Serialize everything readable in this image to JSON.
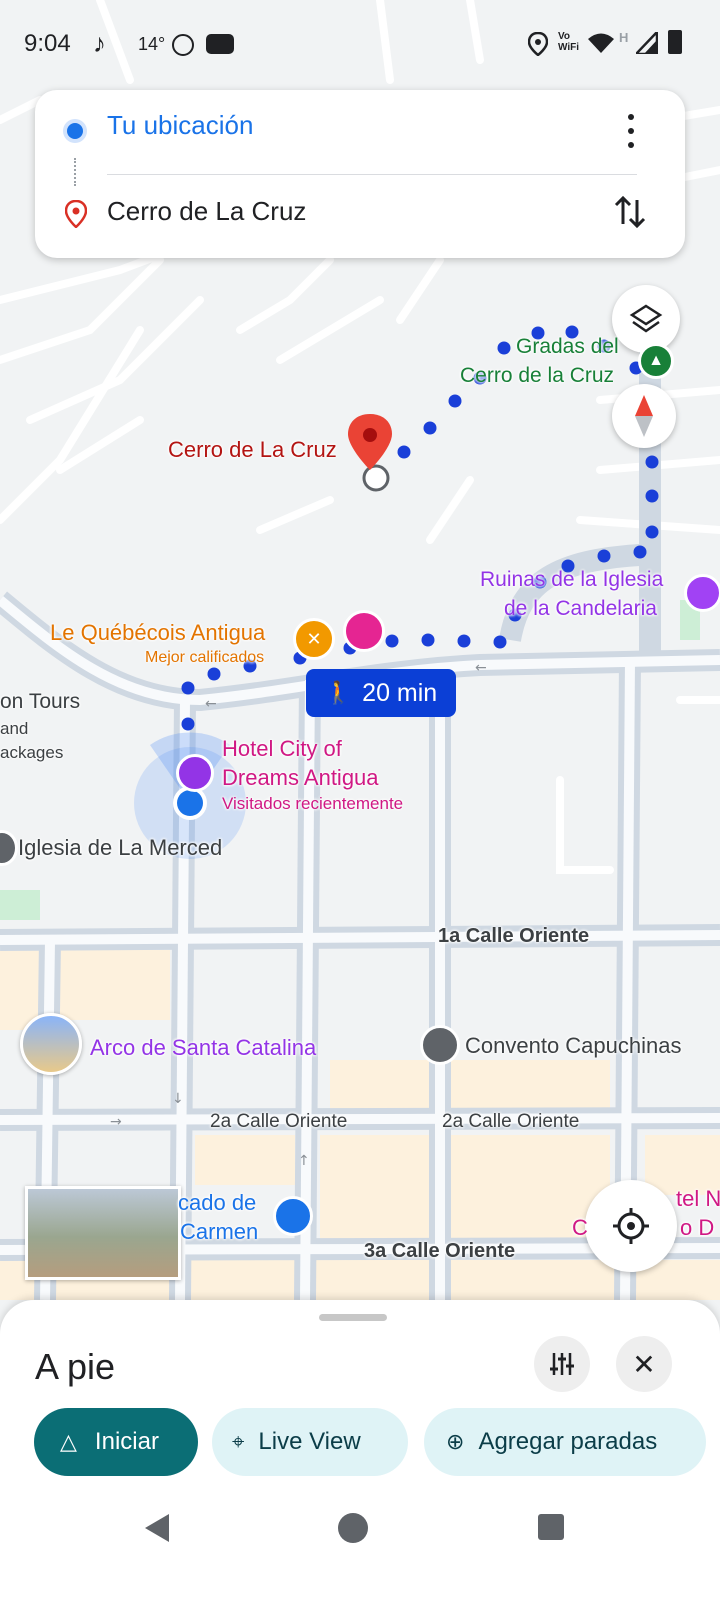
{
  "status_bar": {
    "time": "9:04",
    "temperature": "14°",
    "icons": [
      "tiktok-icon",
      "screen-record-icon",
      "youtube-icon",
      "location-icon",
      "vowifi-icon",
      "wifi-icon",
      "signal-icon",
      "battery-icon"
    ],
    "vowifi_top": "Vo",
    "vowifi_bottom": "WiFi",
    "network_letter": "H"
  },
  "directions": {
    "origin": "Tu ubicación",
    "destination": "Cerro de La Cruz"
  },
  "map": {
    "destination_pin_label": "Cerro de La Cruz",
    "places": {
      "gradas_line1": "Gradas del",
      "gradas_line2": "Cerro de la Cruz",
      "ruinas_line1": "Ruinas de la Iglesia",
      "ruinas_line2": "de la Candelaria",
      "quebecois_name": "Le Québécois Antigua",
      "quebecois_sub": "Mejor calificados",
      "tours_line1": "on Tours",
      "tours_line2": "and",
      "tours_line3": "ackages",
      "hotel_line1": "Hotel City of",
      "hotel_line2": "Dreams Antigua",
      "hotel_sub": "Visitados recientemente",
      "iglesia_merced": "Iglesia de La Merced",
      "arco": "Arco de Santa Catalina",
      "convento": "Convento Capuchinas",
      "mercado_line1": "cado de",
      "mercado_line2": "Carmen",
      "right_edge_line1": "tel N",
      "right_edge_line2": "C",
      "right_edge_line3": "o D"
    },
    "streets": {
      "calle1": "1a Calle Oriente",
      "calle2_left": "2a Calle Oriente",
      "calle2_right": "2a Calle Oriente",
      "calle3": "3a Calle Oriente"
    },
    "route_time": "20 min",
    "route_color": "#1a3fd8"
  },
  "bottom_sheet": {
    "mode_title": "A pie",
    "start_label": "Iniciar",
    "live_view_label": "Live View",
    "add_stops_label": "Agregar paradas",
    "accent_color": "#0b6e75"
  }
}
